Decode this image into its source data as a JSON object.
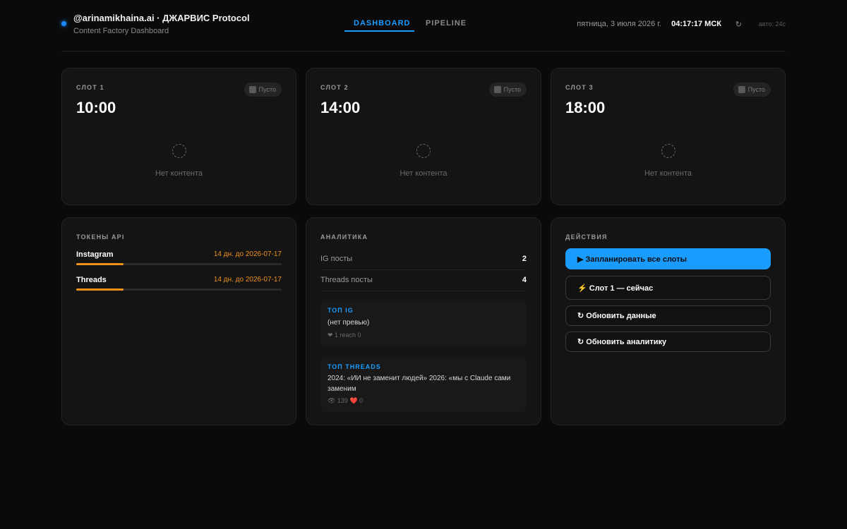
{
  "header": {
    "title": "@arinamikhaina.ai · ДЖАРВИС Protocol",
    "subtitle": "Content Factory Dashboard",
    "tabs": [
      {
        "label": "DASHBOARD",
        "active": true
      },
      {
        "label": "PIPELINE",
        "active": false
      }
    ],
    "date": "пятница, 3 июля 2026 г.",
    "time": "04:17:17 МСК",
    "refresh_icon": "↻",
    "auto_label": "авто: 24с"
  },
  "slots": [
    {
      "label": "СЛОТ 1",
      "time": "10:00",
      "status": "Пусто",
      "empty_text": "Нет контента"
    },
    {
      "label": "СЛОТ 2",
      "time": "14:00",
      "status": "Пусто",
      "empty_text": "Нет контента"
    },
    {
      "label": "СЛОТ 3",
      "time": "18:00",
      "status": "Пусто",
      "empty_text": "Нет контента"
    }
  ],
  "tokens": {
    "title": "ТОКЕНЫ API",
    "items": [
      {
        "name": "Instagram",
        "expiry": "14 дн. до 2026-07-17",
        "remaining_fraction": 0.23
      },
      {
        "name": "Threads",
        "expiry": "14 дн. до 2026-07-17",
        "remaining_fraction": 0.23
      }
    ]
  },
  "analytics": {
    "title": "АНАЛИТИКА",
    "stats": [
      {
        "label": "IG посты",
        "value": "2"
      },
      {
        "label": "Threads посты",
        "value": "4"
      }
    ],
    "top_ig": {
      "title": "ТОП IG",
      "text": "(нет превью)",
      "meta": "❤ 1 reach 0"
    },
    "top_threads": {
      "title": "ТОП THREADS",
      "text": "2024: «ИИ не заменит людей» 2026: «мы с Claude сами заменим",
      "meta": "👁 139 ❤️ 0"
    }
  },
  "actions": {
    "title": "ДЕЙСТВИЯ",
    "buttons": [
      {
        "label": "▶ Запланировать все слоты"
      },
      {
        "label": "⚡ Слот 1 — сейчас"
      },
      {
        "label": "↻ Обновить данные"
      },
      {
        "label": "↻ Обновить аналитику"
      }
    ]
  },
  "colors": {
    "accent": "#1a9cff",
    "warning": "#f0901a",
    "background": "#0a0a0a"
  }
}
